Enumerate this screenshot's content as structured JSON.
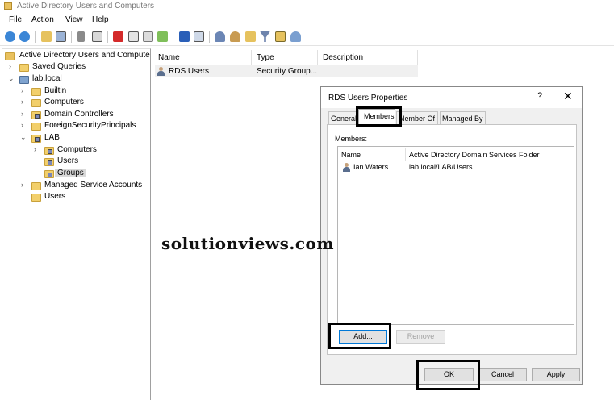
{
  "window": {
    "title": "Active Directory Users and Computers"
  },
  "menu": [
    "File",
    "Action",
    "View",
    "Help"
  ],
  "toolbar_icons": [
    "back-icon",
    "forward-icon",
    "up-folder-icon",
    "show-tree-icon",
    "cut-icon",
    "copy-icon",
    "delete-icon",
    "properties-icon",
    "refresh-icon",
    "export-icon",
    "help-icon",
    "console-icon",
    "new-user-icon",
    "new-group-icon",
    "new-ou-icon",
    "filter-icon",
    "find-icon",
    "add-to-group-icon"
  ],
  "tree": {
    "root": "Active Directory Users and Computers",
    "saved_queries": "Saved Queries",
    "domain": "lab.local",
    "builtin": "Builtin",
    "computers": "Computers",
    "domain_controllers": "Domain Controllers",
    "fsp": "ForeignSecurityPrincipals",
    "lab": "LAB",
    "lab_computers": "Computers",
    "lab_users": "Users",
    "lab_groups": "Groups",
    "msa": "Managed Service Accounts",
    "users": "Users"
  },
  "list": {
    "columns": [
      "Name",
      "Type",
      "Description"
    ],
    "rows": [
      {
        "name": "RDS Users",
        "type": "Security Group...",
        "description": ""
      }
    ]
  },
  "dialog": {
    "title": "RDS Users Properties",
    "help": "?",
    "close": "✕",
    "tabs": [
      "General",
      "Members",
      "Member Of",
      "Managed By"
    ],
    "active_tab": "Members",
    "members_label": "Members:",
    "columns": [
      "Name",
      "Active Directory Domain Services Folder"
    ],
    "members": [
      {
        "name": "Ian Waters",
        "folder": "lab.local/LAB/Users"
      }
    ],
    "add": "Add...",
    "remove": "Remove",
    "ok": "OK",
    "cancel": "Cancel",
    "apply": "Apply"
  },
  "watermark": "solutionviews.com"
}
